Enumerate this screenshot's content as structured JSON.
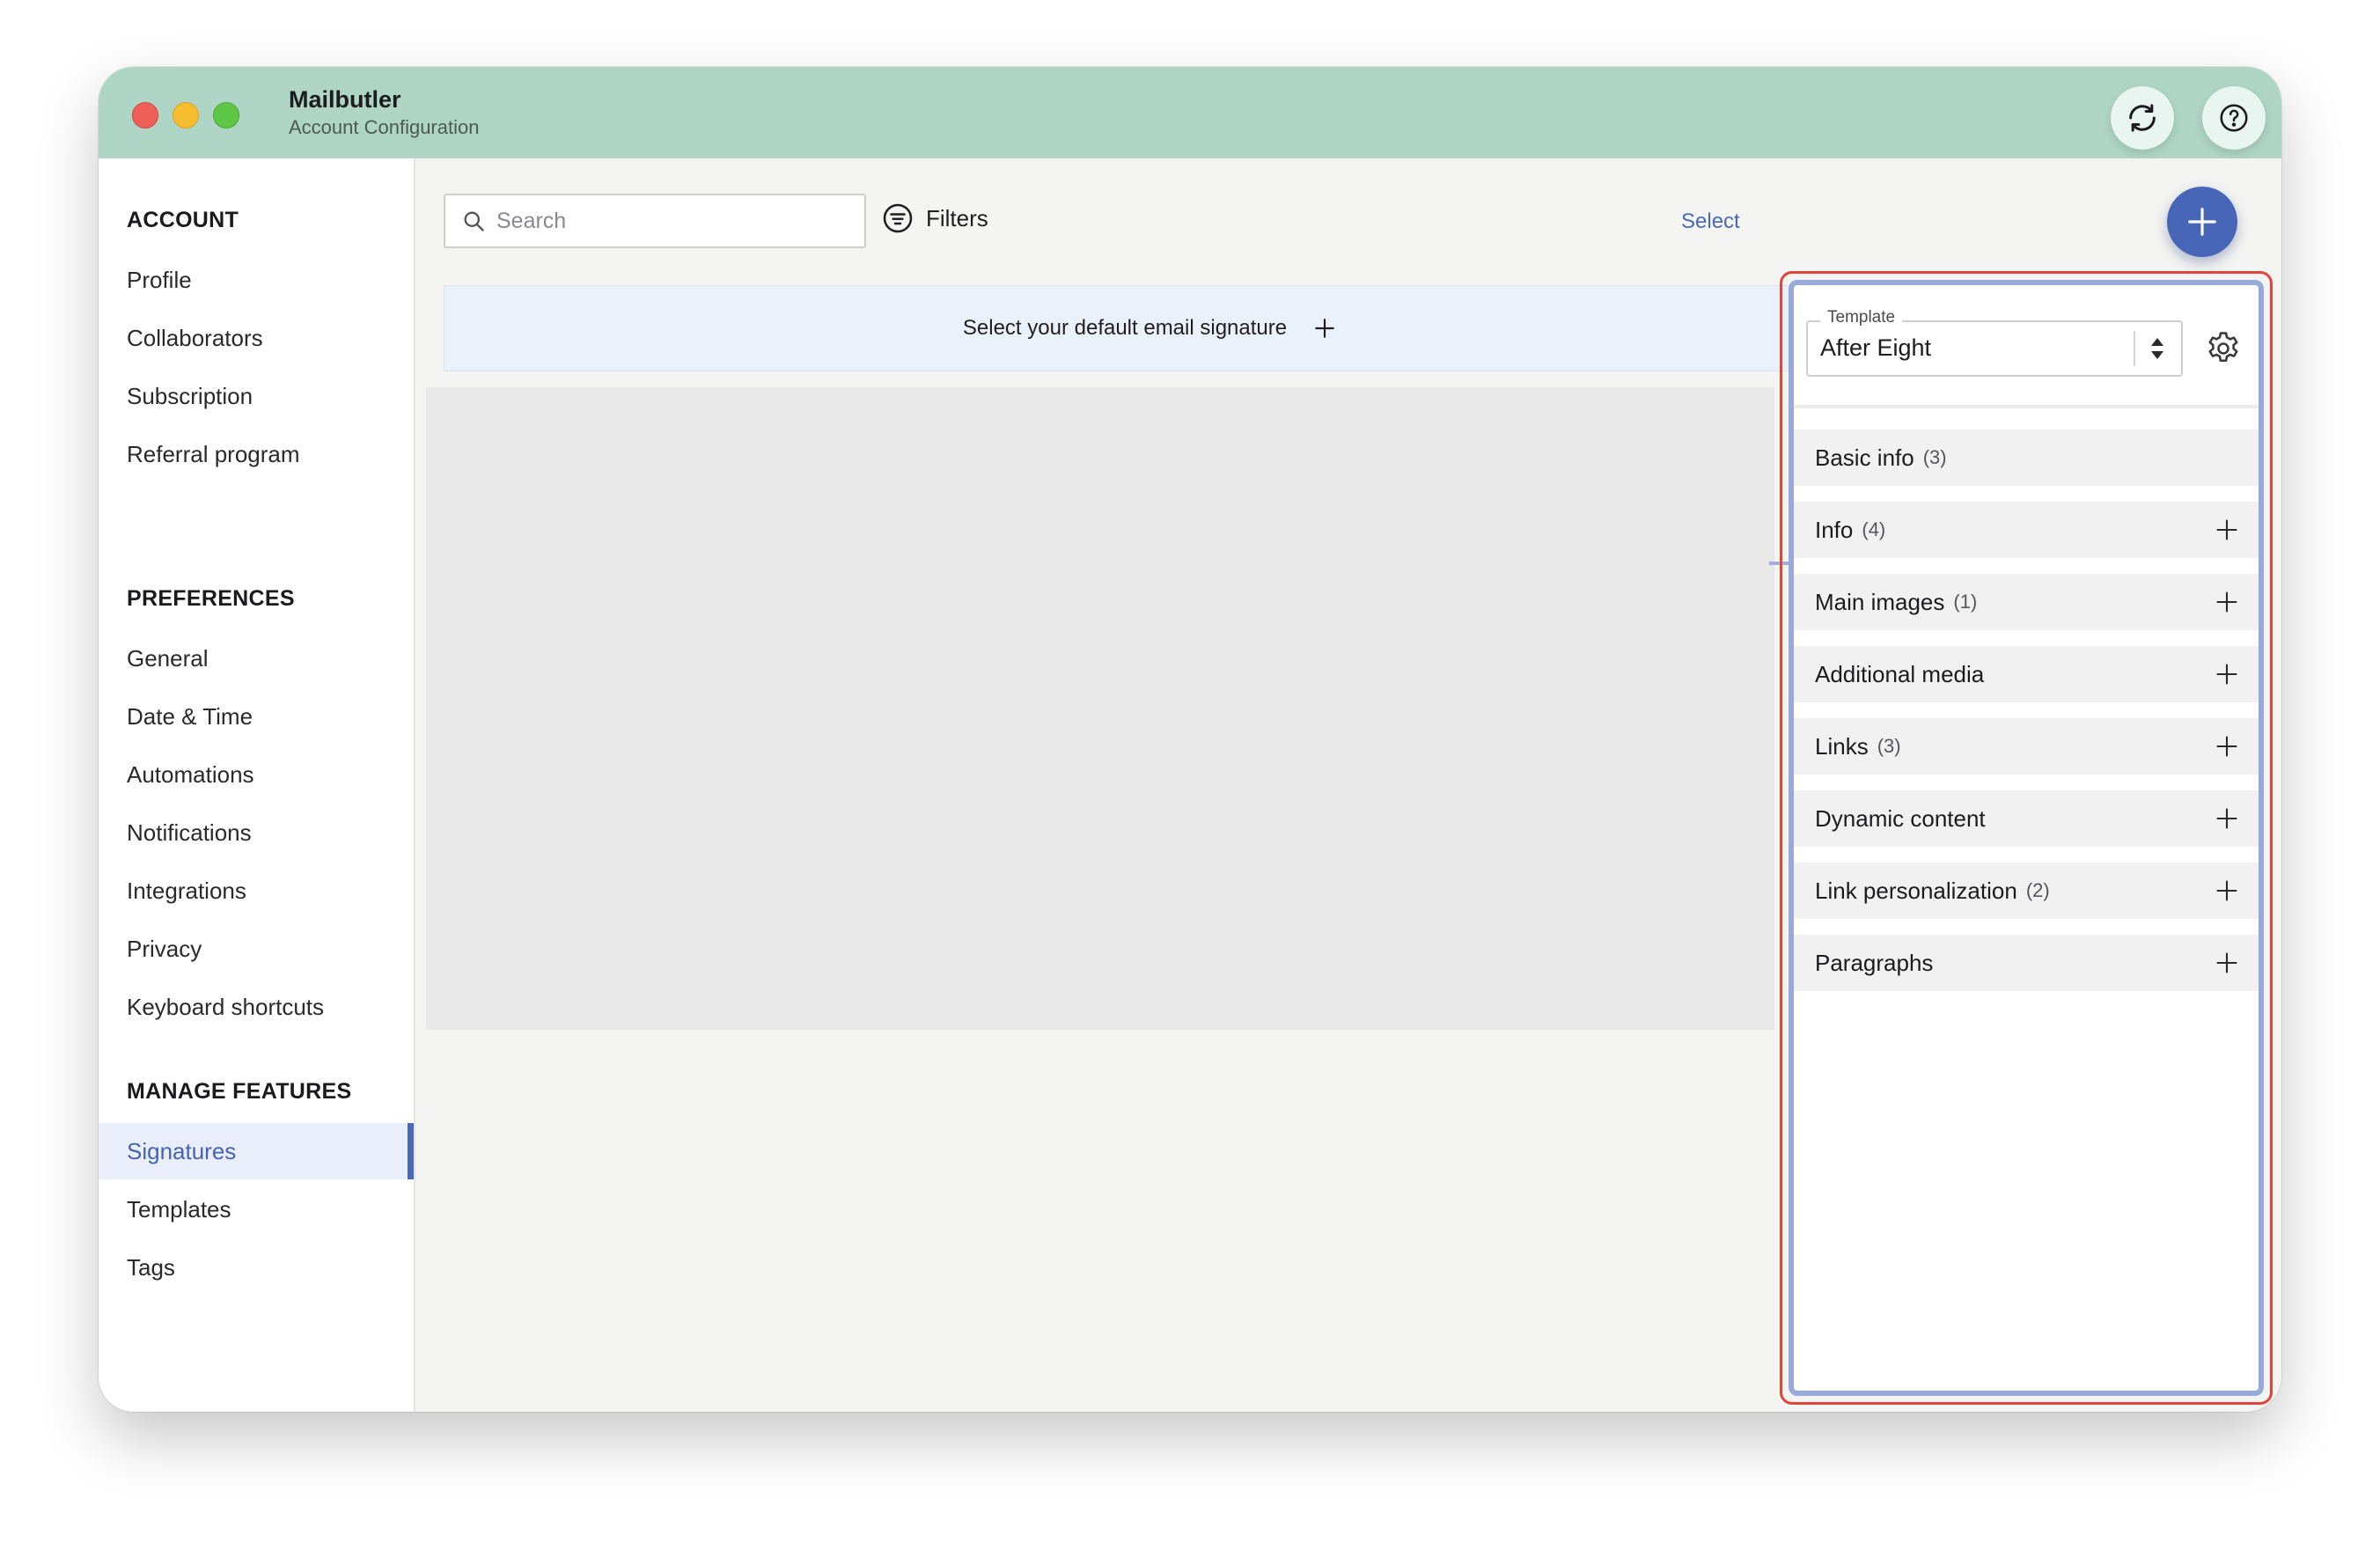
{
  "app": {
    "title": "Mailbutler",
    "subtitle": "Account Configuration"
  },
  "header": {
    "sync_icon": "sync-icon",
    "help_icon": "question-circle-icon"
  },
  "sidebar": {
    "sections": [
      {
        "title": "ACCOUNT",
        "items": [
          "Profile",
          "Collaborators",
          "Subscription",
          "Referral program"
        ]
      },
      {
        "title": "PREFERENCES",
        "items": [
          "General",
          "Date & Time",
          "Automations",
          "Notifications",
          "Integrations",
          "Privacy",
          "Keyboard shortcuts"
        ]
      },
      {
        "title": "MANAGE FEATURES",
        "items": [
          "Signatures",
          "Templates",
          "Tags"
        ]
      }
    ],
    "active_item": "Signatures"
  },
  "toolbar": {
    "search_placeholder": "Search",
    "filters_label": "Filters",
    "select_label": "Select",
    "add_icon": "plus-icon"
  },
  "default_signature": {
    "label": "Select your default email signature"
  },
  "editor": {
    "template_label": "Template",
    "template_value": "After Eight",
    "settings_icon": "gear-icon",
    "categories": [
      {
        "label": "Basic info",
        "count": "(3)",
        "expandable": false
      },
      {
        "label": "Info",
        "count": "(4)",
        "expandable": true
      },
      {
        "label": "Main images",
        "count": "(1)",
        "expandable": true
      },
      {
        "label": "Additional media",
        "count": "",
        "expandable": true
      },
      {
        "label": "Links",
        "count": "(3)",
        "expandable": true
      },
      {
        "label": "Dynamic content",
        "count": "",
        "expandable": true
      },
      {
        "label": "Link personalization",
        "count": "(2)",
        "expandable": true
      },
      {
        "label": "Paragraphs",
        "count": "",
        "expandable": true
      }
    ]
  },
  "colors": {
    "titlebar": "#aed5c6",
    "accent": "#4866b7",
    "highlight_outline": "#e2463a",
    "panel_border": "#97abd9"
  }
}
